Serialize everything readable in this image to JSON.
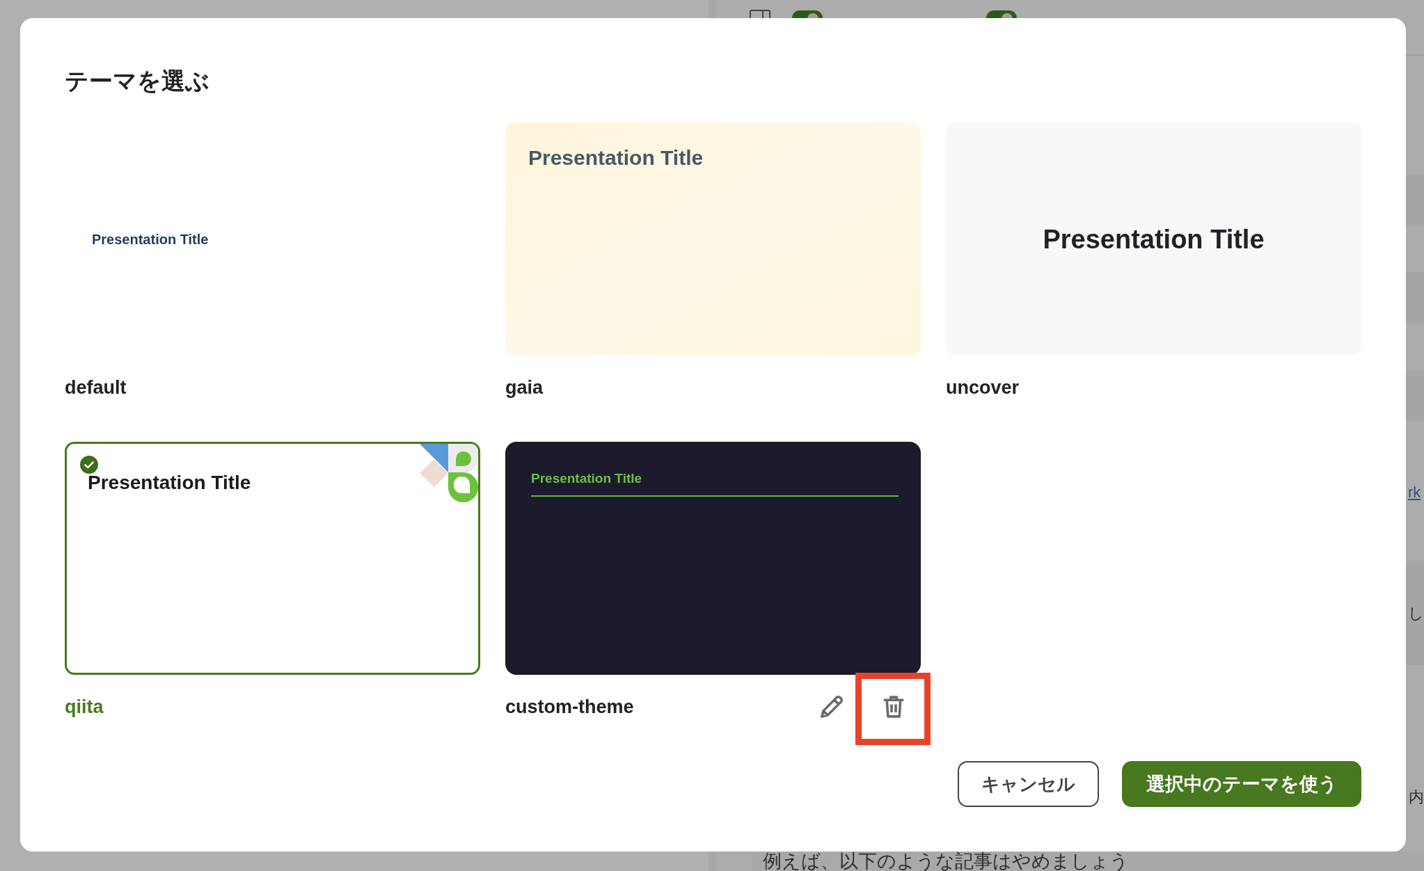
{
  "background": {
    "toolbar": {
      "toggles": [
        {
          "on": true
        },
        {
          "on": true
        }
      ]
    },
    "side_fragments": [
      {
        "kind": "link",
        "text": "rk"
      },
      {
        "kind": "text",
        "text": "し"
      },
      {
        "kind": "text",
        "text": "内"
      }
    ],
    "editor_text": "例えば、以下のような記事はやめましょう"
  },
  "dialog": {
    "title": "テーマを選ぶ",
    "themes": [
      {
        "name": "default",
        "kind": "default",
        "slide_title": "Presentation Title",
        "selected": false
      },
      {
        "name": "gaia",
        "kind": "gaia",
        "slide_title": "Presentation Title",
        "selected": false
      },
      {
        "name": "uncover",
        "kind": "uncover",
        "slide_title": "Presentation Title",
        "selected": false
      },
      {
        "name": "qiita",
        "kind": "qiita",
        "slide_title": "Presentation Title",
        "selected": true
      },
      {
        "name": "custom-theme",
        "kind": "custom",
        "slide_title": "Presentation Title",
        "selected": false,
        "actions": [
          {
            "kind": "edit",
            "highlighted": false
          },
          {
            "kind": "delete",
            "highlighted": true
          }
        ]
      }
    ],
    "buttons": [
      {
        "label": "キャンセル",
        "kind": "secondary"
      },
      {
        "label": "選択中のテーマを使う",
        "kind": "primary"
      }
    ]
  }
}
